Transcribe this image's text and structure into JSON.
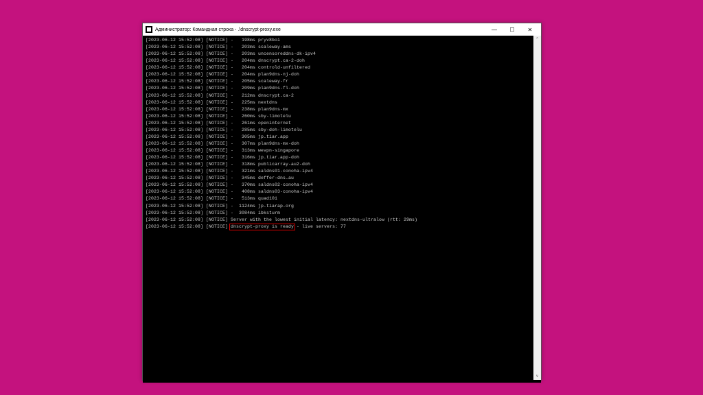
{
  "window": {
    "title": "Администратор: Командная строка - .\\dnscrypt-proxy.exe"
  },
  "log": {
    "timestamp": "[2023-06-12 15:52:08]",
    "level": "[NOTICE]",
    "lines": [
      {
        "latency": "198ms",
        "server": "pryv8boi"
      },
      {
        "latency": "203ms",
        "server": "scaleway-ams"
      },
      {
        "latency": "203ms",
        "server": "uncensoreddns-dk-ipv4"
      },
      {
        "latency": "204ms",
        "server": "dnscrypt.ca-2-doh"
      },
      {
        "latency": "204ms",
        "server": "controld-unfiltered"
      },
      {
        "latency": "204ms",
        "server": "plan9dns-nj-doh"
      },
      {
        "latency": "205ms",
        "server": "scaleway-fr"
      },
      {
        "latency": "209ms",
        "server": "plan9dns-fl-doh"
      },
      {
        "latency": "212ms",
        "server": "dnscrypt.ca-2"
      },
      {
        "latency": "225ms",
        "server": "nextdns"
      },
      {
        "latency": "238ms",
        "server": "plan9dns-mx"
      },
      {
        "latency": "260ms",
        "server": "sby-limotelu"
      },
      {
        "latency": "261ms",
        "server": "openinternet"
      },
      {
        "latency": "285ms",
        "server": "sby-doh-limotelu"
      },
      {
        "latency": "305ms",
        "server": "jp.tiar.app"
      },
      {
        "latency": "307ms",
        "server": "plan9dns-mx-doh"
      },
      {
        "latency": "313ms",
        "server": "wevpn-singapore"
      },
      {
        "latency": "316ms",
        "server": "jp.tiar.app-doh"
      },
      {
        "latency": "318ms",
        "server": "publicarray-au2-doh"
      },
      {
        "latency": "321ms",
        "server": "saldns01-conoha-ipv4"
      },
      {
        "latency": "345ms",
        "server": "deffer-dns.au"
      },
      {
        "latency": "370ms",
        "server": "saldns02-conoha-ipv4"
      },
      {
        "latency": "408ms",
        "server": "saldns03-conoha-ipv4"
      },
      {
        "latency": "513ms",
        "server": "quad101"
      },
      {
        "latency": "1124ms",
        "server": "jp.tiarap.org"
      },
      {
        "latency": "3084ms",
        "server": "ibksturm"
      }
    ],
    "summary1": "Server with the lowest initial latency: nextdns-ultralow (rtt: 29ms)",
    "summary2_prefix": "",
    "summary2_highlight": "dnscrypt-proxy is ready",
    "summary2_suffix": " - live servers: 77"
  },
  "controls": {
    "minimize": "—",
    "maximize": "☐",
    "close": "✕"
  }
}
